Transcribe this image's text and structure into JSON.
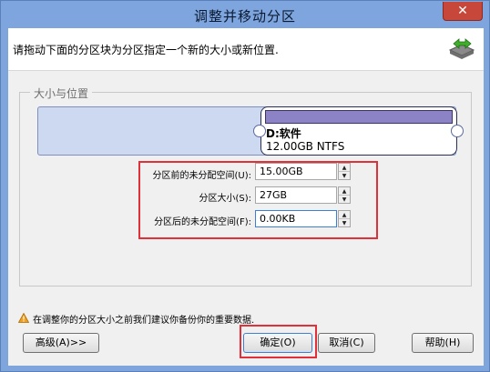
{
  "window": {
    "title": "调整并移动分区",
    "close_glyph": "✕"
  },
  "header": {
    "text": "请拖动下面的分区块为分区指定一个新的大小或新位置."
  },
  "group": {
    "label": "大小与位置"
  },
  "partition": {
    "name": "D:软件",
    "size_fs": "12.00GB NTFS",
    "accent": "#8c82c6"
  },
  "fields": {
    "before": {
      "label": "分区前的未分配空间(U):",
      "value": "15.00GB"
    },
    "size": {
      "label": "分区大小(S):",
      "value": "27GB"
    },
    "after": {
      "label": "分区后的未分配空间(F):",
      "value": "0.00KB"
    }
  },
  "warning": {
    "text": "在调整你的分区大小之前我们建议你备份你的重要数据."
  },
  "buttons": {
    "advanced": "高级(A)>>",
    "ok": "确定(O)",
    "cancel": "取消(C)",
    "help": "帮助(H)"
  },
  "colors": {
    "highlight": "#e0303a",
    "titlebar": "#7ea5dd"
  }
}
